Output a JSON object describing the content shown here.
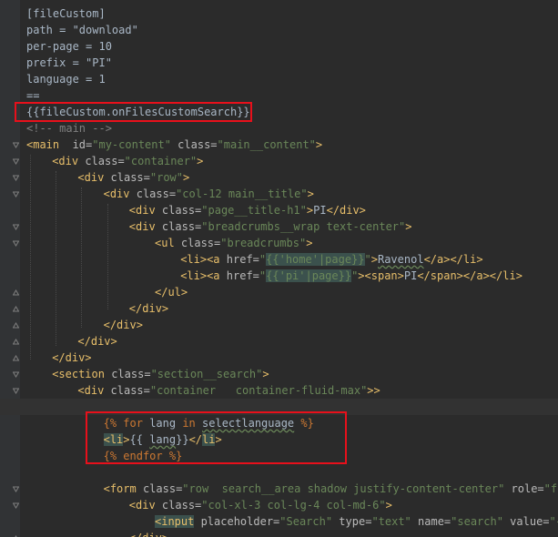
{
  "lines": [
    {
      "fold": "",
      "indent": 0,
      "tokens": [
        {
          "c": "plain",
          "t": "[fileCustom]"
        }
      ]
    },
    {
      "fold": "",
      "indent": 0,
      "tokens": [
        {
          "c": "plain",
          "t": "path = \"download\""
        }
      ]
    },
    {
      "fold": "",
      "indent": 0,
      "tokens": [
        {
          "c": "plain",
          "t": "per-page = 10"
        }
      ]
    },
    {
      "fold": "",
      "indent": 0,
      "tokens": [
        {
          "c": "plain",
          "t": "prefix = \"PI\""
        }
      ]
    },
    {
      "fold": "",
      "indent": 0,
      "tokens": [
        {
          "c": "plain",
          "t": "language = 1"
        }
      ]
    },
    {
      "fold": "",
      "indent": 0,
      "tokens": [
        {
          "c": "plain",
          "t": "=="
        }
      ]
    },
    {
      "fold": "",
      "indent": 0,
      "tokens": [
        {
          "c": "plain",
          "t": "{{fileCustom.onFilesCustomSearch}}"
        }
      ]
    },
    {
      "fold": "",
      "indent": 0,
      "tokens": [
        {
          "c": "comment",
          "t": "<!-- main -->"
        }
      ]
    },
    {
      "fold": "open",
      "indent": 0,
      "tokens": [
        {
          "c": "tag",
          "t": "<main"
        },
        {
          "c": "attr",
          "t": "  id="
        },
        {
          "c": "val",
          "t": "\"my-content\""
        },
        {
          "c": "attr",
          "t": " class="
        },
        {
          "c": "val",
          "t": "\"main__content\""
        },
        {
          "c": "tag",
          "t": ">"
        }
      ]
    },
    {
      "fold": "open",
      "indent": 1,
      "tokens": [
        {
          "c": "tag",
          "t": "<div"
        },
        {
          "c": "attr",
          "t": " class="
        },
        {
          "c": "val",
          "t": "\"container\""
        },
        {
          "c": "tag",
          "t": ">"
        }
      ]
    },
    {
      "fold": "open",
      "indent": 2,
      "tokens": [
        {
          "c": "tag",
          "t": "<div"
        },
        {
          "c": "attr",
          "t": " class="
        },
        {
          "c": "val",
          "t": "\"row\""
        },
        {
          "c": "tag",
          "t": ">"
        }
      ]
    },
    {
      "fold": "open",
      "indent": 3,
      "tokens": [
        {
          "c": "tag",
          "t": "<div"
        },
        {
          "c": "attr",
          "t": " class="
        },
        {
          "c": "val",
          "t": "\"col-12 main__title\""
        },
        {
          "c": "tag",
          "t": ">"
        }
      ]
    },
    {
      "fold": "",
      "indent": 4,
      "tokens": [
        {
          "c": "tag",
          "t": "<div"
        },
        {
          "c": "attr",
          "t": " class="
        },
        {
          "c": "val",
          "t": "\"page__title-h1\""
        },
        {
          "c": "tag",
          "t": ">"
        },
        {
          "c": "plain",
          "t": "PI"
        },
        {
          "c": "tag",
          "t": "</div>"
        }
      ]
    },
    {
      "fold": "open",
      "indent": 4,
      "tokens": [
        {
          "c": "tag",
          "t": "<div"
        },
        {
          "c": "attr",
          "t": " class="
        },
        {
          "c": "val",
          "t": "\"breadcrumbs__wrap text-center\""
        },
        {
          "c": "tag",
          "t": ">"
        }
      ]
    },
    {
      "fold": "open",
      "indent": 5,
      "tokens": [
        {
          "c": "tag",
          "t": "<ul"
        },
        {
          "c": "attr",
          "t": " class="
        },
        {
          "c": "val",
          "t": "\"breadcrumbs\""
        },
        {
          "c": "tag",
          "t": ">"
        }
      ]
    },
    {
      "fold": "",
      "indent": 6,
      "tokens": [
        {
          "c": "tag",
          "t": "<li><a"
        },
        {
          "c": "attr",
          "t": " href="
        },
        {
          "c": "val",
          "t": "\""
        },
        {
          "c": "valhl",
          "t": "{{'home'|page}}"
        },
        {
          "c": "val",
          "t": "\""
        },
        {
          "c": "tag",
          "t": ">"
        },
        {
          "c": "squig",
          "t": "Ravenol"
        },
        {
          "c": "tag",
          "t": "</a></li>"
        }
      ]
    },
    {
      "fold": "",
      "indent": 6,
      "tokens": [
        {
          "c": "tag",
          "t": "<li><a"
        },
        {
          "c": "attr",
          "t": " href="
        },
        {
          "c": "val",
          "t": "\""
        },
        {
          "c": "valhl",
          "t": "{{'pi'|page}}"
        },
        {
          "c": "val",
          "t": "\""
        },
        {
          "c": "tag",
          "t": "><span>"
        },
        {
          "c": "plain",
          "t": "PI"
        },
        {
          "c": "tag",
          "t": "</span></a></li>"
        }
      ]
    },
    {
      "fold": "close",
      "indent": 5,
      "tokens": [
        {
          "c": "tag",
          "t": "</ul>"
        }
      ]
    },
    {
      "fold": "close",
      "indent": 4,
      "tokens": [
        {
          "c": "tag",
          "t": "</div>"
        }
      ]
    },
    {
      "fold": "close",
      "indent": 3,
      "tokens": [
        {
          "c": "tag",
          "t": "</div>"
        }
      ]
    },
    {
      "fold": "close",
      "indent": 2,
      "tokens": [
        {
          "c": "tag",
          "t": "</div>"
        }
      ]
    },
    {
      "fold": "close",
      "indent": 1,
      "tokens": [
        {
          "c": "tag",
          "t": "</div>"
        }
      ]
    },
    {
      "fold": "open",
      "indent": 1,
      "tokens": [
        {
          "c": "tag",
          "t": "<section"
        },
        {
          "c": "attr",
          "t": " class="
        },
        {
          "c": "val",
          "t": "\"section__search\""
        },
        {
          "c": "tag",
          "t": ">"
        }
      ]
    },
    {
      "fold": "open",
      "indent": 2,
      "tokens": [
        {
          "c": "tag",
          "t": "<div"
        },
        {
          "c": "attr",
          "t": " class="
        },
        {
          "c": "val",
          "t": "\"container   container-fluid-max\""
        },
        {
          "c": "tag",
          "t": ">>"
        }
      ]
    },
    {
      "fold": "",
      "indent": 0,
      "current": true,
      "tokens": []
    },
    {
      "fold": "",
      "indent": 3,
      "tokens": [
        {
          "c": "tw",
          "t": "{% "
        },
        {
          "c": "tw",
          "t": "for"
        },
        {
          "c": "twblock",
          "t": " lang "
        },
        {
          "c": "tw",
          "t": "in"
        },
        {
          "c": "twblock",
          "t": " "
        },
        {
          "c": "squigw",
          "t": "selectlanguage"
        },
        {
          "c": "tw",
          "t": " %}"
        }
      ]
    },
    {
      "fold": "",
      "indent": 3,
      "tokens": [
        {
          "c": "taghl",
          "t": "<li"
        },
        {
          "c": "tag",
          "t": ">"
        },
        {
          "c": "plain",
          "t": "{{ "
        },
        {
          "c": "squigw",
          "t": "lang"
        },
        {
          "c": "plain",
          "t": "}}"
        },
        {
          "c": "tag",
          "t": "</"
        },
        {
          "c": "taghl",
          "t": "li"
        },
        {
          "c": "tag",
          "t": ">"
        }
      ]
    },
    {
      "fold": "",
      "indent": 3,
      "tokens": [
        {
          "c": "tw",
          "t": "{% "
        },
        {
          "c": "tw",
          "t": "endfor"
        },
        {
          "c": "tw",
          "t": " %}"
        }
      ]
    },
    {
      "fold": "",
      "indent": 0,
      "tokens": []
    },
    {
      "fold": "open",
      "indent": 3,
      "tokens": [
        {
          "c": "tag",
          "t": "<form"
        },
        {
          "c": "attr",
          "t": " class="
        },
        {
          "c": "val",
          "t": "\"row  search__area shadow justify-content-center\""
        },
        {
          "c": "attr",
          "t": " role="
        },
        {
          "c": "val",
          "t": "\"form\""
        }
      ]
    },
    {
      "fold": "open",
      "indent": 4,
      "tokens": [
        {
          "c": "tag",
          "t": "<div"
        },
        {
          "c": "attr",
          "t": " class="
        },
        {
          "c": "val",
          "t": "\"col-xl-3 col-lg-4 col-md-6\""
        },
        {
          "c": "tag",
          "t": ">"
        }
      ]
    },
    {
      "fold": "",
      "indent": 5,
      "tokens": [
        {
          "c": "taghl",
          "t": "<input"
        },
        {
          "c": "attr",
          "t": " placeholder="
        },
        {
          "c": "val",
          "t": "\"Search\""
        },
        {
          "c": "attr",
          "t": " type="
        },
        {
          "c": "val",
          "t": "\"text\""
        },
        {
          "c": "attr",
          "t": " name="
        },
        {
          "c": "val",
          "t": "\"search\""
        },
        {
          "c": "attr",
          "t": " value="
        },
        {
          "c": "val",
          "t": "\"{{search}}\""
        }
      ]
    },
    {
      "fold": "close",
      "indent": 4,
      "tokens": [
        {
          "c": "tag",
          "t": "</div>"
        }
      ]
    }
  ]
}
